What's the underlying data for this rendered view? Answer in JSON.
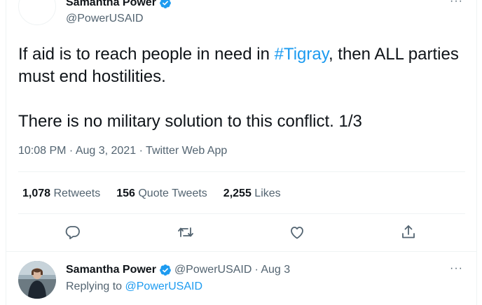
{
  "tweet": {
    "author_name": "Samantha Power",
    "author_handle": "@PowerUSAID",
    "text_line1_pre": "If aid is to reach people in need in ",
    "hashtag": "#Tigray",
    "text_line1_post": ", then ALL parties must end hostilities.",
    "text_line2": "There is no military solution to this conflict. 1/3",
    "timestamp": "10:08 PM · Aug 3, 2021 · Twitter Web App",
    "more_glyph": "···",
    "stats": {
      "retweets_count": "1,078",
      "retweets_label": "Retweets",
      "quotes_count": "156",
      "quotes_label": "Quote Tweets",
      "likes_count": "2,255",
      "likes_label": "Likes"
    }
  },
  "reply": {
    "author_name": "Samantha Power",
    "author_handle": "@PowerUSAID",
    "date": "· Aug 3",
    "replying_prefix": "Replying to",
    "replying_handle": "@PowerUSAID",
    "more_glyph": "···"
  },
  "colors": {
    "link_blue": "#1d9bf0",
    "text_primary": "#0f1419",
    "text_secondary": "#536471",
    "divider": "#eff3f4"
  },
  "icons": [
    "verified-badge-icon",
    "reply-icon",
    "retweet-icon",
    "like-icon",
    "share-icon",
    "more-icon"
  ]
}
